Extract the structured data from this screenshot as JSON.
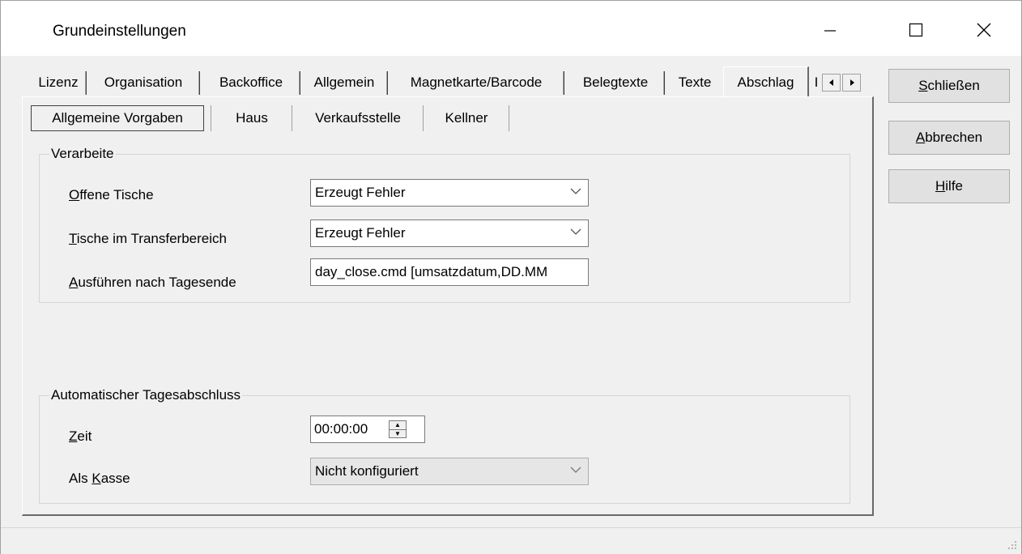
{
  "window": {
    "title": "Grundeinstellungen",
    "minimize_glyph": "—",
    "maximize_glyph": "☐",
    "close_glyph": "✕"
  },
  "tabs": [
    {
      "label": "Lizenz"
    },
    {
      "label": "Organisation"
    },
    {
      "label": "Backoffice"
    },
    {
      "label": "Allgemein"
    },
    {
      "label": "Magnetkarte/Barcode"
    },
    {
      "label": "Belegtexte"
    },
    {
      "label": "Texte"
    },
    {
      "label": "Abschlag",
      "active": true
    },
    {
      "label": "I"
    }
  ],
  "subtabs": [
    {
      "label": "Allgemeine Vorgaben",
      "active": true
    },
    {
      "label": "Haus"
    },
    {
      "label": "Verkaufsstelle"
    },
    {
      "label": "Kellner"
    }
  ],
  "verarbeite": {
    "caption": "Verarbeite",
    "offene_tische": {
      "label_prefix": "",
      "label_accel": "O",
      "label_rest": "ffene Tische",
      "value": "Erzeugt Fehler"
    },
    "transfer": {
      "label_accel": "T",
      "label_rest": "ische im Transferbereich",
      "value": "Erzeugt Fehler"
    },
    "ausfuehren": {
      "label_accel": "A",
      "label_rest": "usführen nach Tagesende",
      "value": "day_close.cmd [umsatzdatum,DD.MM"
    }
  },
  "auto": {
    "caption": "Automatischer Tagesabschluss",
    "zeit": {
      "label_accel": "Z",
      "label_rest": "eit",
      "value": "00:00:00"
    },
    "kasse": {
      "label_prefix": "Als ",
      "label_accel": "K",
      "label_rest": "asse",
      "value": "Nicht konfiguriert"
    }
  },
  "buttons": {
    "schliessen": {
      "accel": "S",
      "rest": "chließen"
    },
    "abbrechen": {
      "accel": "A",
      "rest": "bbrechen"
    },
    "hilfe": {
      "accel": "H",
      "rest": "ilfe"
    }
  },
  "icons": {
    "minimize": "minimize-icon",
    "maximize": "maximize-icon",
    "close": "close-icon",
    "dropdown": "chevron-down-icon"
  }
}
